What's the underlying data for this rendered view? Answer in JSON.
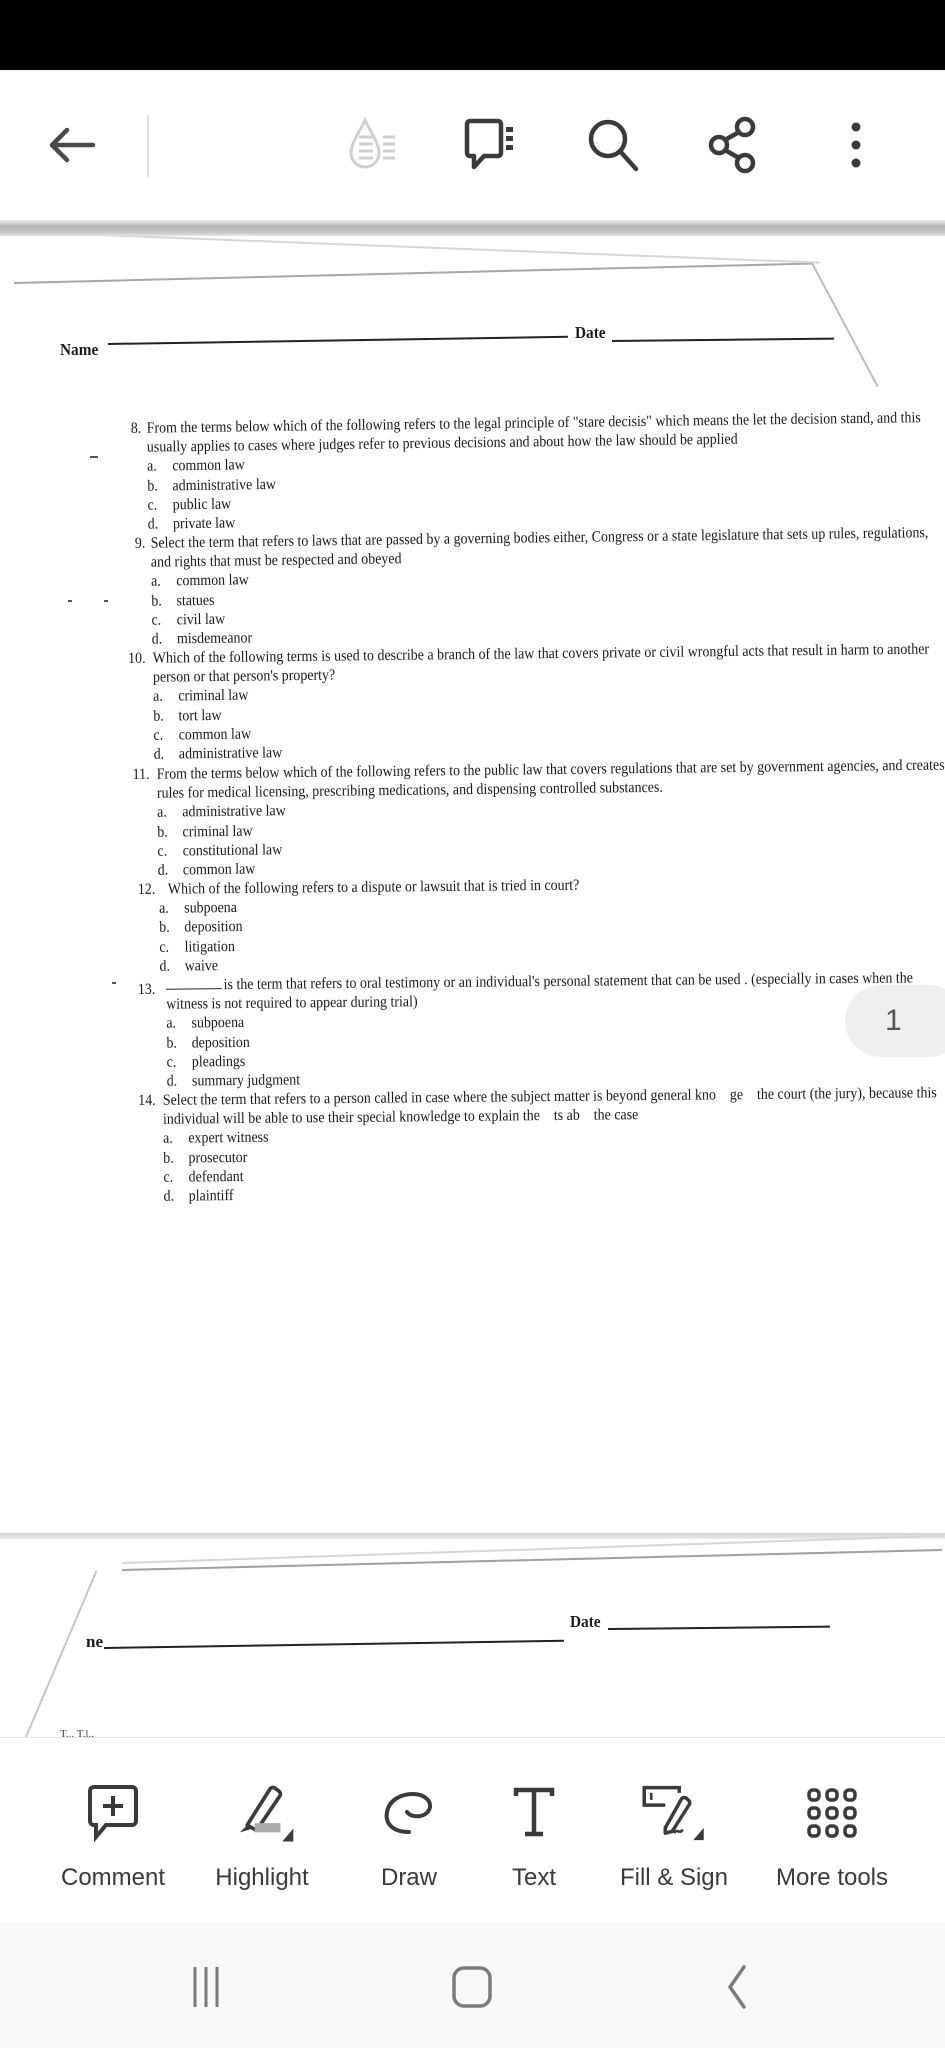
{
  "app_bar": {
    "icons": [
      "back-arrow-icon",
      "liquid-mode-icon",
      "comments-list-icon",
      "search-icon",
      "share-icon",
      "more-options-icon"
    ]
  },
  "document": {
    "header": {
      "name_label": "Name",
      "date_label": "Date"
    },
    "questions": [
      {
        "number": "8.",
        "text": "From the terms below which of the following refers to the legal principle of \"stare decisis\" which means the let the decision stand, and this usually applies to cases where judges refer to previous decisions and about how the law should be applied",
        "options": [
          {
            "letter": "a.",
            "text": "common law"
          },
          {
            "letter": "b.",
            "text": "administrative law"
          },
          {
            "letter": "c.",
            "text": "public law"
          },
          {
            "letter": "d.",
            "text": "private law"
          }
        ]
      },
      {
        "number": "9.",
        "text": "Select the term that refers to laws that are passed by a governing bodies either, Congress or a state legislature that sets up rules, regulations, and rights that must be respected and obeyed",
        "options": [
          {
            "letter": "a.",
            "text": "common law"
          },
          {
            "letter": "b.",
            "text": "statues"
          },
          {
            "letter": "c.",
            "text": "civil law"
          },
          {
            "letter": "d.",
            "text": "misdemeanor"
          }
        ]
      },
      {
        "number": "10.",
        "text": "Which of the following terms is used to describe a branch of the law that covers private or civil wrongful acts that result in harm to another person or that person's property?",
        "options": [
          {
            "letter": "a.",
            "text": "criminal law"
          },
          {
            "letter": "b.",
            "text": "tort law"
          },
          {
            "letter": "c.",
            "text": "common law"
          },
          {
            "letter": "d.",
            "text": "administrative law"
          }
        ]
      },
      {
        "number": "11.",
        "text": "From the terms below which of the following refers to the public law that covers regulations that are set by government agencies, and creates rules for medical licensing, prescribing medications, and dispensing controlled substances.",
        "options": [
          {
            "letter": "a.",
            "text": "administrative law"
          },
          {
            "letter": "b.",
            "text": "criminal law"
          },
          {
            "letter": "c.",
            "text": "constitutional law"
          },
          {
            "letter": "d.",
            "text": "common law"
          }
        ]
      },
      {
        "number": "12.",
        "text": "Which of the following refers to a dispute or lawsuit that is tried in court?",
        "options": [
          {
            "letter": "a.",
            "text": "subpoena"
          },
          {
            "letter": "b.",
            "text": "deposition"
          },
          {
            "letter": "c.",
            "text": "litigation"
          },
          {
            "letter": "d.",
            "text": "waive"
          }
        ]
      },
      {
        "number": "13.",
        "text": "is the term that refers to oral testimony or an individual's personal statement that can be used . (especially in cases when the witness is not required to appear during trial)",
        "options": [
          {
            "letter": "a.",
            "text": "subpoena"
          },
          {
            "letter": "b.",
            "text": "deposition"
          },
          {
            "letter": "c.",
            "text": "pleadings"
          },
          {
            "letter": "d.",
            "text": "summary judgment"
          }
        ]
      },
      {
        "number": "14.",
        "text": "Select the term that refers to a person called in case where the subject matter is beyond general kno    ge    the court (the jury), because this individual will be able to use their special knowledge to explain the    ts ab    the case",
        "options": [
          {
            "letter": "a.",
            "text": "expert witness"
          },
          {
            "letter": "b.",
            "text": "prosecutor"
          },
          {
            "letter": "c.",
            "text": "defendant"
          },
          {
            "letter": "d.",
            "text": "plaintiff"
          }
        ]
      }
    ],
    "next_page": {
      "name_label_partial": "ne",
      "date_label": "Date",
      "partial_text": "T... T.l.."
    }
  },
  "page_indicator": {
    "current_page": "1"
  },
  "toolbar": {
    "tools": [
      {
        "label": "Comment",
        "icon": "comment-add-icon"
      },
      {
        "label": "Highlight",
        "icon": "highlight-icon"
      },
      {
        "label": "Draw",
        "icon": "draw-icon"
      },
      {
        "label": "Text",
        "icon": "text-icon"
      },
      {
        "label": "Fill & Sign",
        "icon": "fill-sign-icon"
      },
      {
        "label": "More tools",
        "icon": "more-tools-grid-icon"
      }
    ]
  },
  "nav_bar": {
    "buttons": [
      "recent-apps-icon",
      "home-icon",
      "back-icon"
    ]
  }
}
